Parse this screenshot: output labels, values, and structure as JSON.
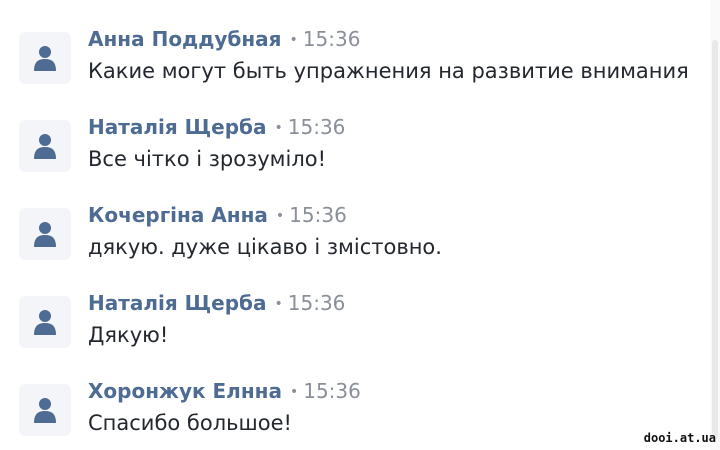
{
  "messages": [
    {
      "author": "Анна Поддубная",
      "time": "15:36",
      "text": "Какие могут быть упражнения на развитие внимания"
    },
    {
      "author": "Наталія Щерба",
      "time": "15:36",
      "text": "Все чітко і зрозуміло!"
    },
    {
      "author": "Кочергіна Анна",
      "time": "15:36",
      "text": "дякую. дуже цікаво і змістовно."
    },
    {
      "author": "Наталія Щерба",
      "time": "15:36",
      "text": "Дякую!"
    },
    {
      "author": "Хоронжук Елнна",
      "time": "15:36",
      "text": "Спасибо большое!"
    }
  ],
  "separator": "•",
  "watermark": "dooi.at.ua",
  "icons": {
    "avatar": "user-icon"
  },
  "colors": {
    "author": "#4e6b93",
    "time": "#8a8f99",
    "text": "#23272e",
    "avatar_bg": "#f3f5f9",
    "avatar_icon": "#4e6b93"
  }
}
